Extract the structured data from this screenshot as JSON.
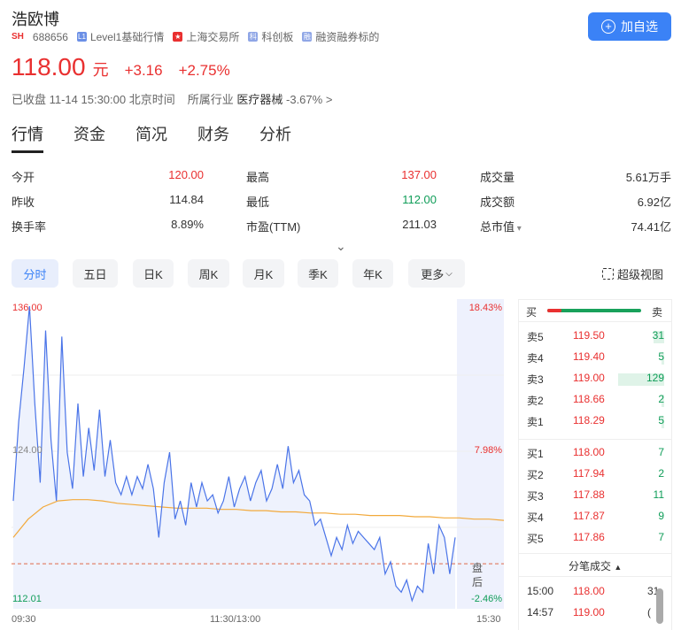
{
  "header": {
    "name": "浩欧博",
    "market_badge": "SH",
    "code": "688656",
    "tags": [
      "Level1基础行情",
      "上海交易所",
      "科创板",
      "融资融券标的"
    ],
    "tag_icons": [
      "level1-icon",
      "china-flag-icon",
      "star-market-icon",
      "margin-icon"
    ],
    "add_button": "加自选"
  },
  "quote": {
    "price": "118.00",
    "unit": "元",
    "change": "+3.16",
    "change_pct": "+2.75%",
    "status": "已收盘 11-14 15:30:00 北京时间",
    "industry_label": "所属行业",
    "industry_name": "医疗器械",
    "industry_pct": "-3.67%",
    "industry_arrow": ">"
  },
  "tabs": [
    "行情",
    "资金",
    "简况",
    "财务",
    "分析"
  ],
  "stats": [
    {
      "label": "今开",
      "value": "120.00",
      "color": "#e93030"
    },
    {
      "label": "最高",
      "value": "137.00",
      "color": "#e93030"
    },
    {
      "label": "成交量",
      "value": "5.61万手",
      "color": "#333333"
    },
    {
      "label": "昨收",
      "value": "114.84",
      "color": "#333333"
    },
    {
      "label": "最低",
      "value": "112.00",
      "color": "#0f9d58"
    },
    {
      "label": "成交额",
      "value": "6.92亿",
      "color": "#333333"
    },
    {
      "label": "换手率",
      "value": "8.89%",
      "color": "#333333"
    },
    {
      "label": "市盈(TTM)",
      "value": "211.03",
      "color": "#333333"
    },
    {
      "label": "总市值",
      "value": "74.41亿",
      "color": "#333333"
    }
  ],
  "expand_icon": "⌄",
  "periods": [
    "分时",
    "五日",
    "日K",
    "周K",
    "月K",
    "季K",
    "年K",
    "更多"
  ],
  "super_view": "超级视图",
  "chart_data": {
    "type": "line",
    "y_left_top": "136.00",
    "y_left_mid": "124.00",
    "y_left_bottom": "112.01",
    "y_right_top": "18.43%",
    "y_right_mid": "7.98%",
    "y_right_bottom": "-2.46%",
    "x_ticks": [
      "09:30",
      "11:30/13:00",
      "15:30"
    ],
    "after_hours_label": "盘后",
    "ylim": [
      112.01,
      136.0
    ],
    "prev_close": 114.84,
    "price_series": [
      120.0,
      126.5,
      131.0,
      136.0,
      128.0,
      121.5,
      134.0,
      125.0,
      120.0,
      133.5,
      124.0,
      121.0,
      128.0,
      122.0,
      126.0,
      122.5,
      127.5,
      122.0,
      125.0,
      121.5,
      120.5,
      122.0,
      120.5,
      122.0,
      121.0,
      123.0,
      121.0,
      117.0,
      121.5,
      124.0,
      118.5,
      120.0,
      118.0,
      121.5,
      119.5,
      121.5,
      120.0,
      120.5,
      119.0,
      120.0,
      122.0,
      119.5,
      121.0,
      122.0,
      120.0,
      121.5,
      122.5,
      120.0,
      121.0,
      123.0,
      121.0,
      124.5,
      121.5,
      122.5,
      120.5,
      120.0,
      118.0,
      118.5,
      117.0,
      115.5,
      117.0,
      116.0,
      118.0,
      116.5,
      117.5,
      117.0,
      116.5,
      116.0,
      117.0,
      114.0,
      115.0,
      113.0,
      112.5,
      113.5,
      111.8,
      113.0,
      112.5,
      116.5,
      114.0,
      118.0,
      117.0,
      114.0,
      117.0
    ],
    "avg_series": [
      117.0,
      118.5,
      119.5,
      120.0,
      120.1,
      120.1,
      120.0,
      119.8,
      119.7,
      119.6,
      119.5,
      119.4,
      119.4,
      119.4,
      119.3,
      119.3,
      119.2,
      119.2,
      119.1,
      119.1,
      119.0,
      119.0,
      118.9,
      118.9,
      118.8,
      118.8,
      118.8,
      118.7,
      118.7,
      118.6,
      118.6,
      118.5,
      118.5,
      118.4
    ]
  },
  "order_book": {
    "buy_label": "买",
    "sell_label": "卖",
    "asks": [
      {
        "level": "卖5",
        "price": "119.50",
        "vol": "31",
        "ratio": 0.24
      },
      {
        "level": "卖4",
        "price": "119.40",
        "vol": "5",
        "ratio": 0.04
      },
      {
        "level": "卖3",
        "price": "119.00",
        "vol": "129",
        "ratio": 1.0
      },
      {
        "level": "卖2",
        "price": "118.66",
        "vol": "2",
        "ratio": 0.02
      },
      {
        "level": "卖1",
        "price": "118.29",
        "vol": "5",
        "ratio": 0.04
      }
    ],
    "bids": [
      {
        "level": "买1",
        "price": "118.00",
        "vol": "7"
      },
      {
        "level": "买2",
        "price": "117.94",
        "vol": "2"
      },
      {
        "level": "买3",
        "price": "117.88",
        "vol": "11"
      },
      {
        "level": "买4",
        "price": "117.87",
        "vol": "9"
      },
      {
        "level": "买5",
        "price": "117.86",
        "vol": "7"
      }
    ],
    "trades_title": "分笔成交",
    "trades": [
      {
        "time": "15:00",
        "price": "118.00",
        "vol": "31"
      },
      {
        "time": "14:57",
        "price": "119.00",
        "vol": "("
      }
    ]
  }
}
